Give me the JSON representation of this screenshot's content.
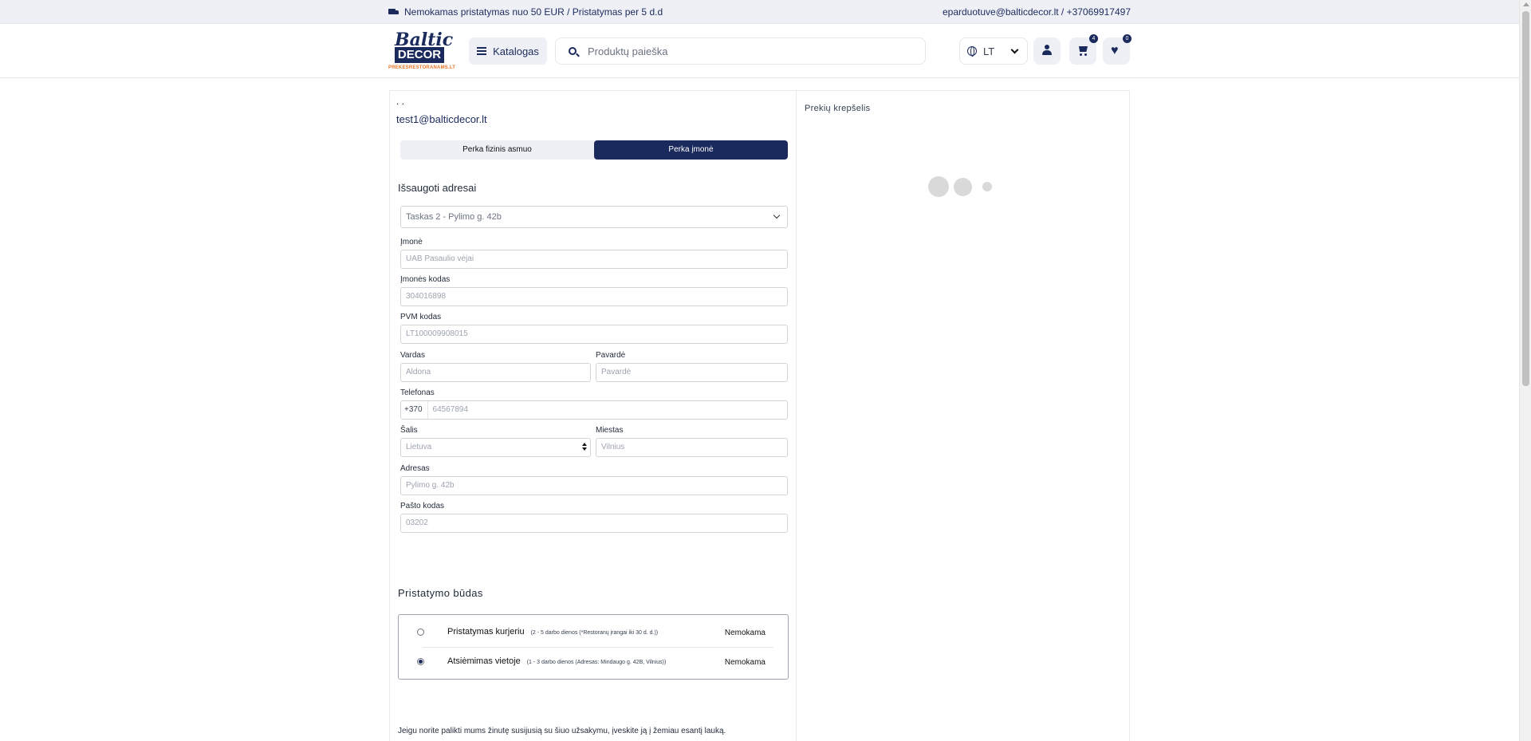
{
  "topbar": {
    "shipping_text": "Nemokamas pristatymas nuo 50 EUR / Pristatymas per 5 d.d",
    "contact_text": "eparduotuve@balticdecor.lt / +37069917497"
  },
  "header": {
    "logo": {
      "line1": "Baltic",
      "line2": "DECOR",
      "line3": "PREKESRESTORANAMS.LT"
    },
    "catalog_label": "Katalogas",
    "search_placeholder": "Produktų paieška",
    "language": "LT",
    "cart_count": "4",
    "wishlist_count": "0"
  },
  "checkout": {
    "name_line": ". .",
    "email": "test1@balticdecor.lt",
    "buyer_types": [
      "Perka fizinis asmuo",
      "Perka įmonė"
    ],
    "active_buyer_type": "Perka įmonė",
    "saved_addresses_title": "Išsaugoti adresai",
    "saved_address_selected": "Taskas 2 - Pylimo g. 42b",
    "fields": {
      "company": {
        "label": "Įmonė",
        "value": "UAB Pasaulio vėjai"
      },
      "company_code": {
        "label": "Įmonės kodas",
        "value": "304016898"
      },
      "vat_code": {
        "label": "PVM kodas",
        "value": "LT100009908015"
      },
      "first_name": {
        "label": "Vardas",
        "value": "Aldona"
      },
      "last_name": {
        "label": "Pavardė",
        "value": "Pavardė"
      },
      "phone": {
        "label": "Telefonas",
        "prefix": "+370",
        "value": "64567894"
      },
      "country": {
        "label": "Šalis",
        "value": "Lietuva"
      },
      "city": {
        "label": "Miestas",
        "value": "Vilnius"
      },
      "address": {
        "label": "Adresas",
        "value": "Pylimo g. 42b"
      },
      "postcode": {
        "label": "Pašto kodas",
        "value": "03202"
      }
    },
    "delivery_title": "Pristatymo būdas",
    "delivery_options": [
      {
        "name": "Pristatymas kurjeriu",
        "note": "(2 - 5 darbo dienos (*Restoranų įrangai iki 30 d. d.))",
        "price": "Nemokama",
        "selected": false
      },
      {
        "name": "Atsiėmimas vietoje",
        "note": "(1 - 3 darbo dienos (Adresas: Mindaugo g. 42B, Vilnius))",
        "price": "Nemokama",
        "selected": true
      }
    ],
    "note_text": "Jeigu norite palikti mums žinutę susijusią su šiuo užsakymu, įveskite ją į žemiau esantį lauką."
  },
  "cart_panel": {
    "title": "Prekių krepšelis"
  },
  "colors": {
    "brand": "#1b2a5c",
    "accent": "#e8752a"
  }
}
